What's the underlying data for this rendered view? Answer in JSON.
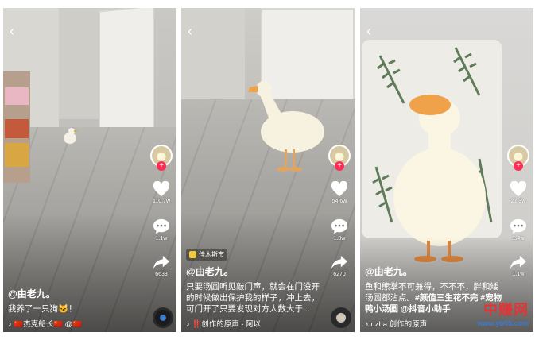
{
  "panels": [
    {
      "handle": "@由老九。",
      "caption": "我养了一只狗🐱！",
      "music": "♪ 🇨🇳杰克船长🇨🇳 @🇨🇳",
      "likes": "110.7w",
      "comments": "1.1w",
      "shares": "6633"
    },
    {
      "poi": "佳木斯市",
      "handle": "@由老九。",
      "caption": "只要汤圆听见敲门声，就会在门没开的时候做出保护我的样子，冲上去，可门开了只要发现对方人数大于...",
      "music": "♪ ‼️创作的原声 - 阿以",
      "likes": "54.6w",
      "comments": "1.8w",
      "shares": "6270"
    },
    {
      "handle": "@由老九。",
      "caption": "鱼和熊掌不可兼得，不不不，胖和矮汤圆都沾点。",
      "tags": "#颜值三生花不完 #宠物鸭小汤圆 @抖音小助手",
      "music": "♪ uzha 创作的原声",
      "likes": "27.3w",
      "comments": "1.4w",
      "shares": "1.1w"
    }
  ],
  "icons": {
    "back": "‹",
    "follow": "+",
    "like": "heart-icon",
    "comment": "comment-icon",
    "share": "share-icon"
  },
  "watermark": {
    "main": "中赚网",
    "sub": "www.yb05.com",
    "color_main": "#e43333",
    "color_sub": "#3a7bd5"
  },
  "colors": {
    "follow": "#fe2c55",
    "poi_icon": "#f2c73b"
  }
}
